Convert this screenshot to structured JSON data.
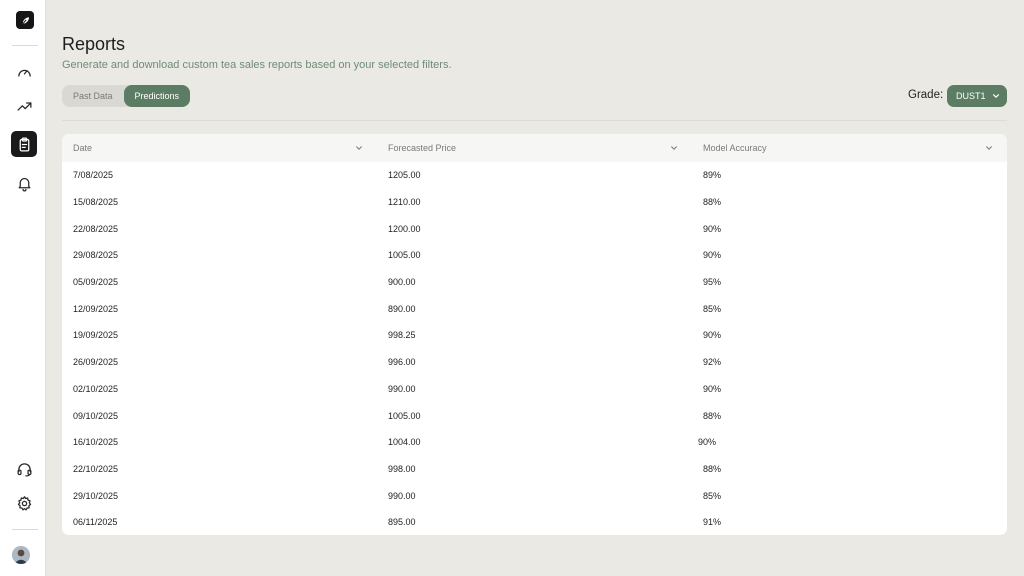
{
  "header": {
    "title": "Reports",
    "subtitle": "Generate and download custom tea sales reports based on your selected filters."
  },
  "tabs": [
    {
      "label": "Past Data",
      "active": false
    },
    {
      "label": "Predictions",
      "active": true
    }
  ],
  "grade": {
    "label": "Grade:",
    "value": "DUST1"
  },
  "table": {
    "columns": [
      "Date",
      "Forecasted Price",
      "Model Accuracy"
    ],
    "rows": [
      [
        "7/08/2025",
        "1205.00",
        "89%"
      ],
      [
        "15/08/2025",
        "1210.00",
        "88%"
      ],
      [
        "22/08/2025",
        "1200.00",
        "90%"
      ],
      [
        "29/08/2025",
        "1005.00",
        "90%"
      ],
      [
        "05/09/2025",
        "900.00",
        "95%"
      ],
      [
        "12/09/2025",
        "890.00",
        "85%"
      ],
      [
        "19/09/2025",
        "998.25",
        "90%"
      ],
      [
        "26/09/2025",
        "996.00",
        "92%"
      ],
      [
        "02/10/2025",
        "990.00",
        "90%"
      ],
      [
        "09/10/2025",
        "1005.00",
        "88%"
      ],
      [
        "16/10/2025",
        "1004.00",
        "90%"
      ],
      [
        "22/10/2025",
        "998.00",
        "88%"
      ],
      [
        "29/10/2025",
        "990.00",
        "85%"
      ],
      [
        "06/11/2025",
        "895.00",
        "91%"
      ]
    ]
  },
  "sidebar": {
    "items": [
      {
        "icon": "gauge-icon",
        "active": false
      },
      {
        "icon": "trending-up-icon",
        "active": false
      },
      {
        "icon": "clipboard-icon",
        "active": true
      },
      {
        "icon": "bell-icon",
        "active": false
      },
      {
        "icon": "headset-icon",
        "active": false
      },
      {
        "icon": "gear-icon",
        "active": false
      }
    ]
  },
  "colors": {
    "accent": "#5c7c63",
    "background": "#ebe9e3",
    "subtitle": "#6f8c76"
  }
}
